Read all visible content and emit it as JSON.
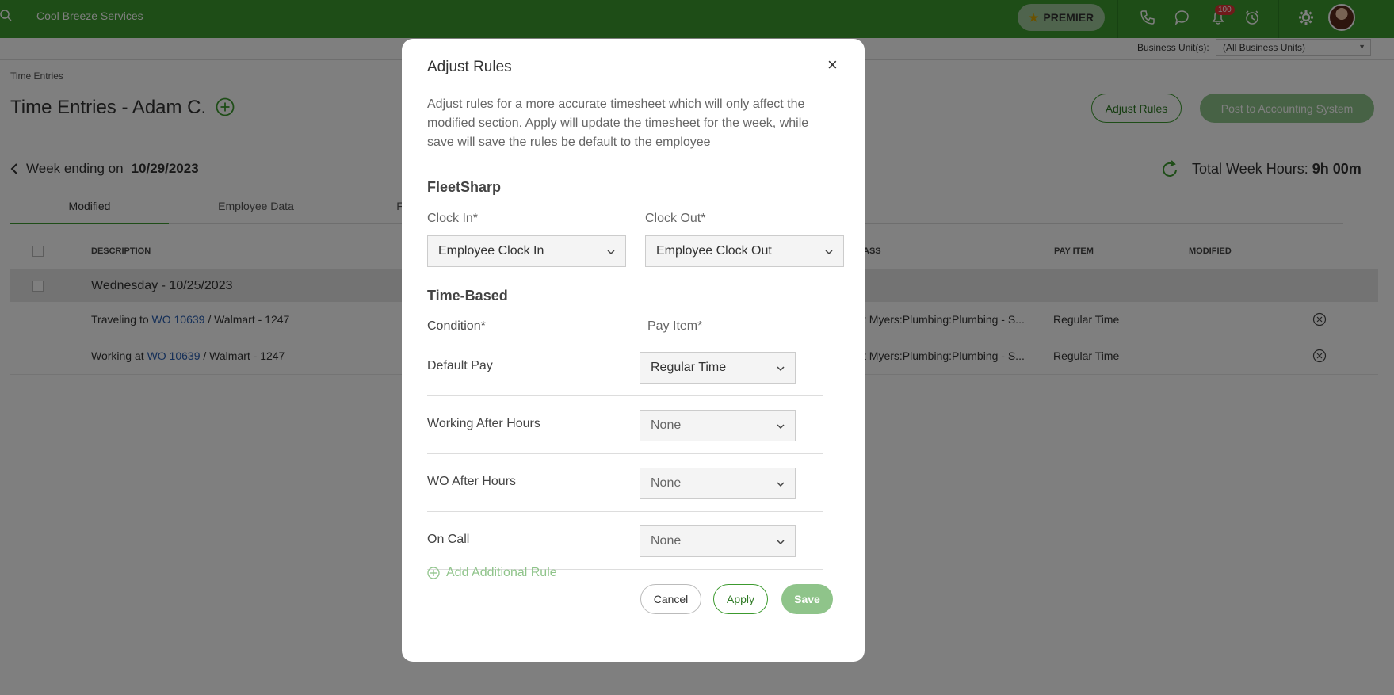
{
  "topbar": {
    "company": "Cool Breeze Services",
    "premier_label": "PREMIER",
    "notification_count": "100",
    "icons": [
      "search-icon",
      "star-icon",
      "phone-icon",
      "chat-icon",
      "bell-icon",
      "alarm-icon",
      "gear-icon"
    ]
  },
  "business_unit": {
    "label": "Business Unit(s):",
    "value": "(All Business Units)"
  },
  "breadcrumb": "Time Entries",
  "page": {
    "title": "Time Entries - Adam C.",
    "adjust_rules_label": "Adjust Rules",
    "post_label": "Post to Accounting System",
    "week_prefix": "Week ending on",
    "week_date": "10/29/2023",
    "total_prefix": "Total Week Hours:",
    "total_value": "9h 00m"
  },
  "tabs": [
    "Modified",
    "Employee Data",
    "Fle"
  ],
  "table": {
    "headers": {
      "description": "DESCRIPTION",
      "class": "ASS",
      "pay_item": "PAY ITEM",
      "modified": "MODIFIED"
    },
    "group": "Wednesday - 10/25/2023",
    "rows": [
      {
        "prefix": "Traveling to",
        "wo": "WO 10639",
        "suffix": "/ Walmart - 1247",
        "class": "t Myers:Plumbing:Plumbing - S...",
        "pay_item": "Regular Time"
      },
      {
        "prefix": "Working at",
        "wo": "WO 10639",
        "suffix": "/ Walmart - 1247",
        "class": "t Myers:Plumbing:Plumbing - S...",
        "pay_item": "Regular Time"
      }
    ]
  },
  "modal": {
    "title": "Adjust Rules",
    "close": "×",
    "description": "Adjust rules for a more accurate timesheet which will only affect the modified section. Apply will update the timesheet for the week, while save will save the rules be default to the employee",
    "fleet_heading": "FleetSharp",
    "clock_in_label": "Clock In*",
    "clock_in_value": "Employee Clock In",
    "clock_out_label": "Clock Out*",
    "clock_out_value": "Employee Clock Out",
    "time_heading": "Time-Based",
    "condition_label": "Condition*",
    "pay_item_label": "Pay Item*",
    "rules": [
      {
        "name": "Default Pay",
        "value": "Regular Time"
      },
      {
        "name": "Working After Hours",
        "value": "None"
      },
      {
        "name": "WO After Hours",
        "value": "None"
      },
      {
        "name": "On Call",
        "value": "None"
      }
    ],
    "add_rule": "Add Additional Rule",
    "cancel": "Cancel",
    "apply": "Apply",
    "save": "Save"
  },
  "colors": {
    "brand_green": "#3c9a2e",
    "muted_green": "#8fc48a",
    "link_blue": "#2a5fb0"
  }
}
